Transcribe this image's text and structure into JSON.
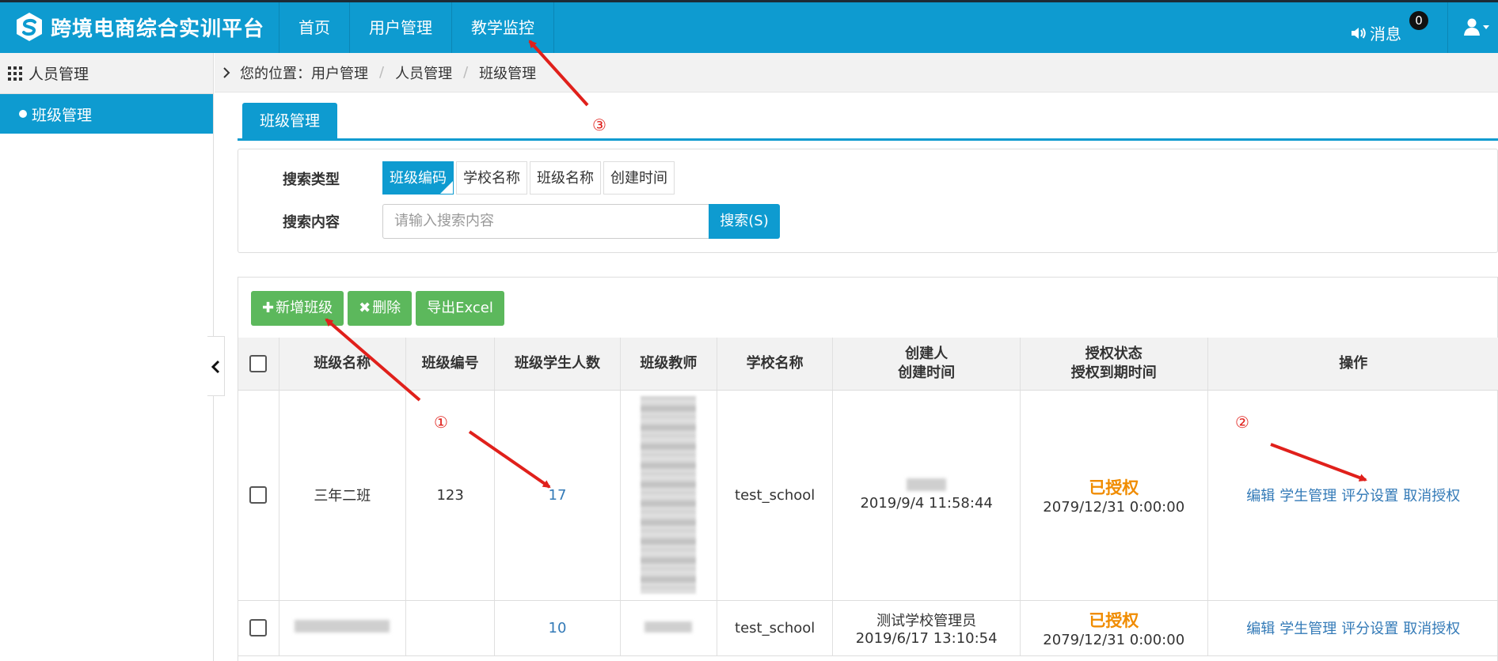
{
  "header": {
    "logo_text": "跨境电商综合实训平台",
    "nav": [
      "首页",
      "用户管理",
      "教学监控"
    ],
    "messages_label": "消息",
    "messages_count": "0"
  },
  "sidebar": {
    "title": "人员管理",
    "items": [
      {
        "label": "班级管理",
        "active": true
      }
    ]
  },
  "breadcrumb": {
    "prefix": "您的位置：",
    "items": [
      "用户管理",
      "人员管理",
      "班级管理"
    ],
    "separator": "/"
  },
  "tab": {
    "label": "班级管理"
  },
  "search": {
    "type_label": "搜索类型",
    "content_label": "搜索内容",
    "types": [
      "班级编码",
      "学校名称",
      "班级名称",
      "创建时间"
    ],
    "selected_type": "班级编码",
    "placeholder": "请输入搜索内容",
    "button": "搜索(S)"
  },
  "toolbar": {
    "add": "新增班级",
    "delete": "删除",
    "export": "导出Excel"
  },
  "table": {
    "headers": {
      "name": "班级名称",
      "code": "班级编号",
      "count": "班级学生人数",
      "teacher": "班级教师",
      "school": "学校名称",
      "creator": "创建人",
      "created": "创建时间",
      "auth": "授权状态",
      "expire": "授权到期时间",
      "ops": "操作"
    },
    "rows": [
      {
        "name": "三年二班",
        "code": "123",
        "count": "17",
        "school": "test_school",
        "creator": "",
        "created": "2019/9/4 11:58:44",
        "auth": "已授权",
        "expire": "2079/12/31 0:00:00"
      },
      {
        "name": "",
        "code": "",
        "count": "10",
        "school": "test_school",
        "creator": "测试学校管理员",
        "created": "2019/6/17 13:10:54",
        "auth": "已授权",
        "expire": "2079/12/31 0:00:00"
      }
    ],
    "ops": [
      "编辑",
      "学生管理",
      "评分设置",
      "取消授权"
    ]
  },
  "annotations": {
    "one": "①",
    "two": "②",
    "three": "③"
  },
  "colors": {
    "primary": "#0e9bd0",
    "success": "#5cb85c",
    "link": "#337ab7",
    "authorized": "#f08c00",
    "annotation": "#e0201b"
  }
}
